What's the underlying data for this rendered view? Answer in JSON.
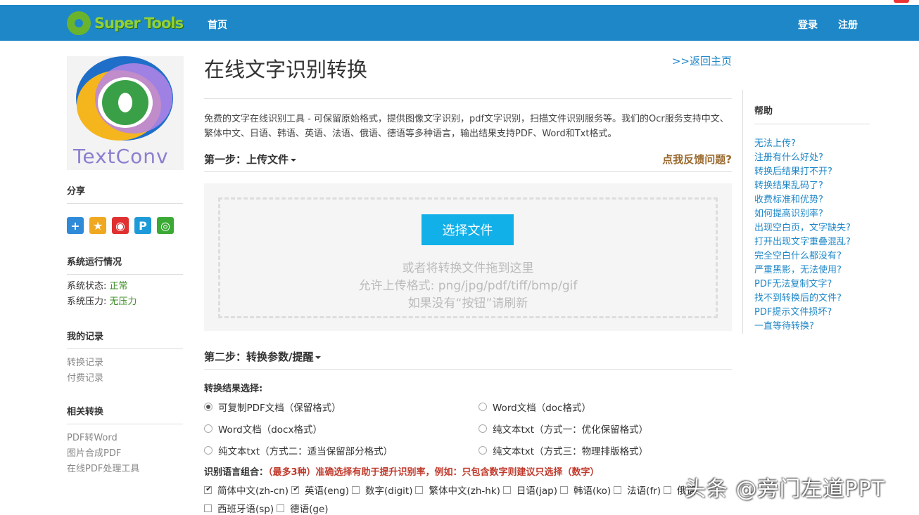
{
  "nav": {
    "logo_text": "Super Tools",
    "home": "首页",
    "login": "登录",
    "register": "注册"
  },
  "left": {
    "logo_word": "TextConv",
    "share_head": "分享",
    "share_icons": [
      {
        "name": "plus-share-icon",
        "glyph": "+",
        "color": "#2f8ad8"
      },
      {
        "name": "qzone-star-icon",
        "glyph": "★",
        "color": "#f0a820"
      },
      {
        "name": "weibo-icon",
        "glyph": "◉",
        "color": "#e03030"
      },
      {
        "name": "p-share-icon",
        "glyph": "P",
        "color": "#1e9ad8"
      },
      {
        "name": "wechat-icon",
        "glyph": "◎",
        "color": "#3aaa35"
      }
    ],
    "sys_head": "系统运行情况",
    "sys_status_label": "系统状态:",
    "sys_status_value": "正常",
    "sys_load_label": "系统压力:",
    "sys_load_value": "无压力",
    "records_head": "我的记录",
    "records": [
      "转换记录",
      "付费记录"
    ],
    "related_head": "相关转换",
    "related": [
      "PDF转Word",
      "图片合成PDF",
      "在线PDF处理工具"
    ]
  },
  "main": {
    "title": "在线文字识别转换",
    "back_link": ">>返回主页",
    "desc": "免费的文字在线识别工具 - 可保留原始格式，提供图像文字识别，pdf文字识别，扫描文件识别服务等。我们的Ocr服务支持中文、繁体中文、日语、韩语、英语、法语、俄语、德语等多种语言，输出结果支持PDF、Word和Txt格式。",
    "step1": "第一步：上传文件",
    "feedback": "点我反馈问题?",
    "select_button": "选择文件",
    "drop_line1": "或者将转换文件拖到这里",
    "drop_line2": "允许上传格式: png/jpg/pdf/tiff/bmp/gif",
    "drop_line3": "如果没有“按钮”请刷新",
    "step2": "第二步：转换参数/提醒",
    "result_head": "转换结果选择:",
    "result_options": [
      {
        "label": "可复制PDF文档（保留格式）",
        "checked": true
      },
      {
        "label": "Word文档（doc格式）",
        "checked": false
      },
      {
        "label": "Word文档（docx格式）",
        "checked": false
      },
      {
        "label": "纯文本txt（方式一：优化保留格式）",
        "checked": false
      },
      {
        "label": "纯文本txt（方式二：适当保留部分格式）",
        "checked": false
      },
      {
        "label": "纯文本txt（方式三：物理排版格式）",
        "checked": false
      }
    ],
    "lang_head": "识别语言组合：",
    "lang_note": "（最多3种）准确选择有助于提升识别率，例如：只包含数字则建议只选择（数字）",
    "languages": [
      {
        "label": "简体中文(zh-cn)",
        "checked": true
      },
      {
        "label": "英语(eng)",
        "checked": true
      },
      {
        "label": "数字(digit)",
        "checked": false
      },
      {
        "label": "繁体中文(zh-hk)",
        "checked": false
      },
      {
        "label": "日语(jap)",
        "checked": false
      },
      {
        "label": "韩语(ko)",
        "checked": false
      },
      {
        "label": "法语(fr)",
        "checked": false
      },
      {
        "label": "俄语",
        "checked": false
      },
      {
        "label": "西班牙语(sp)",
        "checked": false
      },
      {
        "label": "德语(ge)",
        "checked": false
      }
    ]
  },
  "help": {
    "head": "帮助",
    "items": [
      "无法上传?",
      "注册有什么好处?",
      "转换后结果打不开?",
      "转换结果乱码了?",
      "收费标准和优势?",
      "如何提高识别率?",
      "出现空白页，文字缺失?",
      "打开出现文字重叠混乱?",
      "完全空白什么都没有?",
      "严重黑影，无法使用?",
      "PDF无法复制文字?",
      "找不到转换后的文件?",
      "PDF提示文件损坏?",
      "一直等待转换?"
    ]
  },
  "watermark": "头条 @旁门左道PPT"
}
